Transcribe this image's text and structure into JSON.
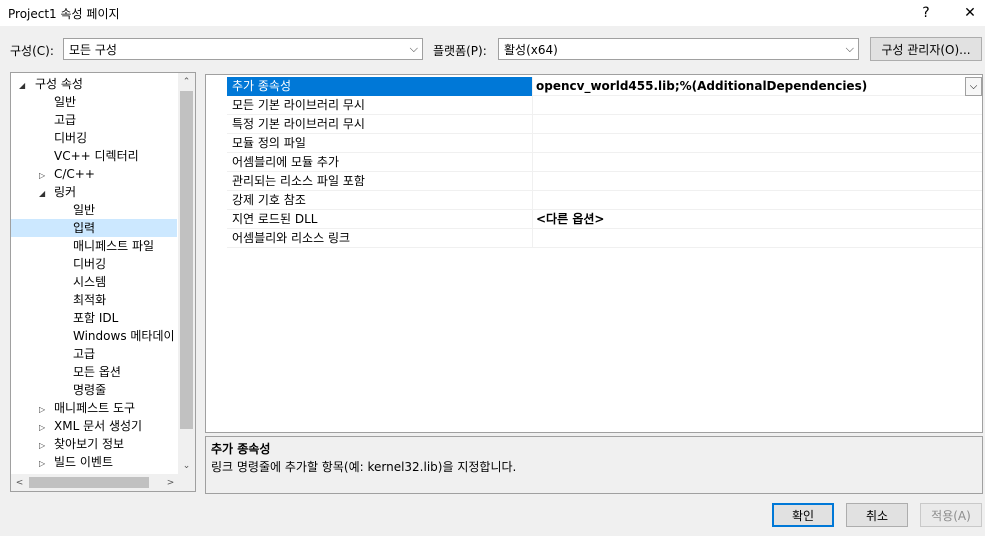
{
  "window": {
    "title": "Project1 속성 페이지",
    "help": "?",
    "close": "✕"
  },
  "config": {
    "label": "구성(C):",
    "value": "모든 구성"
  },
  "platform": {
    "label": "플랫폼(P):",
    "value": "활성(x64)"
  },
  "config_manager": "구성 관리자(O)...",
  "tree": {
    "root": "구성 속성",
    "items": [
      "일반",
      "고급",
      "디버깅",
      "VC++ 디렉터리",
      "C/C++",
      "링커"
    ],
    "linker_items": [
      "일반",
      "입력",
      "매니페스트 파일",
      "디버깅",
      "시스템",
      "최적화",
      "포함 IDL",
      "Windows 메타데이",
      "고급",
      "모든 옵션",
      "명령줄"
    ],
    "after_items": [
      "매니페스트 도구",
      "XML 문서 생성기",
      "찾아보기 정보",
      "빌드 이벤트"
    ]
  },
  "properties": [
    {
      "name": "추가 종속성",
      "value": "opencv_world455.lib;%(AdditionalDependencies)"
    },
    {
      "name": "모든 기본 라이브러리 무시",
      "value": ""
    },
    {
      "name": "특정 기본 라이브러리 무시",
      "value": ""
    },
    {
      "name": "모듈 정의 파일",
      "value": ""
    },
    {
      "name": "어셈블리에 모듈 추가",
      "value": ""
    },
    {
      "name": "관리되는 리소스 파일 포함",
      "value": ""
    },
    {
      "name": "강제 기호 참조",
      "value": ""
    },
    {
      "name": "지연 로드된 DLL",
      "value": "<다른 옵션>"
    },
    {
      "name": "어셈블리와 리소스 링크",
      "value": ""
    }
  ],
  "description": {
    "title": "추가 종속성",
    "text": "링크 명령줄에 추가할 항목(예: kernel32.lib)을 지정합니다."
  },
  "buttons": {
    "ok": "확인",
    "cancel": "취소",
    "apply": "적용(A)"
  },
  "colors": {
    "selection": "#0078d7",
    "tree_selection": "#cce8ff"
  }
}
